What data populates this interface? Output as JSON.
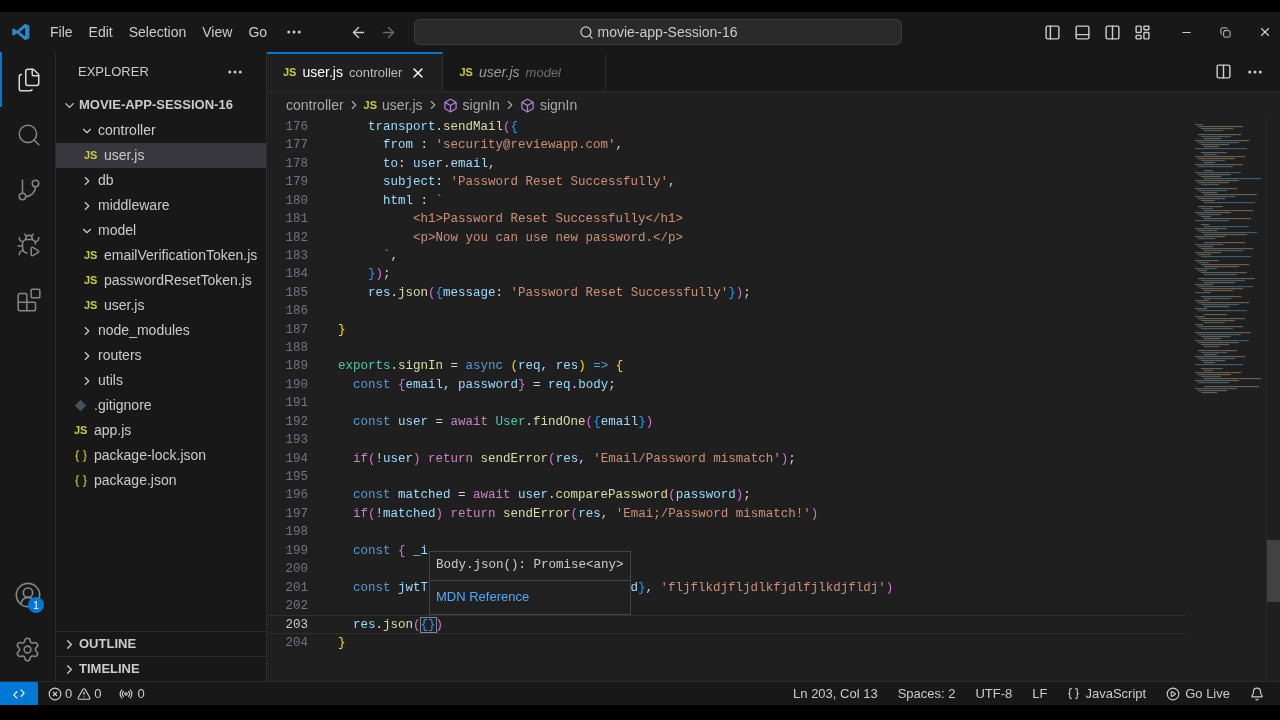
{
  "menu": [
    "File",
    "Edit",
    "Selection",
    "View",
    "Go"
  ],
  "command_center": {
    "value": "movie-app-Session-16"
  },
  "activity_bar": {
    "top": [
      {
        "selected": true
      },
      {
        "selected": false
      },
      {
        "selected": false
      },
      {
        "selected": false
      },
      {
        "selected": false
      }
    ],
    "account_badge": "1"
  },
  "sidebar": {
    "title": "EXPLORER",
    "root": {
      "label": "MOVIE-APP-SESSION-16",
      "expanded": true,
      "children": [
        {
          "kind": "folder",
          "label": "controller",
          "expanded": true,
          "selected": false,
          "children": [
            {
              "kind": "js",
              "label": "user.js",
              "badge": "JS",
              "selected": true
            }
          ]
        },
        {
          "kind": "folder",
          "label": "db",
          "expanded": false,
          "selected": false
        },
        {
          "kind": "folder",
          "label": "middleware",
          "expanded": false,
          "selected": false
        },
        {
          "kind": "folder",
          "label": "model",
          "expanded": true,
          "selected": false,
          "children": [
            {
              "kind": "js",
              "label": "emailVerificationToken.js",
              "badge": "JS",
              "selected": false
            },
            {
              "kind": "js",
              "label": "passwordResetToken.js",
              "badge": "JS",
              "selected": false
            },
            {
              "kind": "js",
              "label": "user.js",
              "badge": "JS",
              "selected": false
            }
          ]
        },
        {
          "kind": "folder",
          "label": "node_modules",
          "expanded": false,
          "selected": false
        },
        {
          "kind": "folder",
          "label": "routers",
          "expanded": false,
          "selected": false
        },
        {
          "kind": "folder",
          "label": "utils",
          "expanded": false,
          "selected": false
        },
        {
          "kind": "git",
          "label": ".gitignore",
          "selected": false
        },
        {
          "kind": "js",
          "label": "app.js",
          "badge": "JS",
          "selected": false
        },
        {
          "kind": "json",
          "label": "package-lock.json",
          "selected": false
        },
        {
          "kind": "json",
          "label": "package.json",
          "selected": false
        }
      ]
    },
    "sections": [
      {
        "label": "OUTLINE",
        "expanded": false
      },
      {
        "label": "TIMELINE",
        "expanded": false
      }
    ]
  },
  "tabs": [
    {
      "label": "user.js",
      "description": "controller",
      "badge": "JS",
      "selected": true,
      "preview": false
    },
    {
      "label": "user.js",
      "description": "model",
      "badge": "JS",
      "selected": false,
      "preview": true
    }
  ],
  "breadcrumbs": [
    {
      "kind": "folder",
      "label": "controller"
    },
    {
      "kind": "file",
      "label": "user.js",
      "badge": "JS"
    },
    {
      "kind": "symbol",
      "label": "signIn"
    },
    {
      "kind": "symbol",
      "label": "signIn"
    }
  ],
  "code": [
    {
      "number": "176",
      "active": false,
      "tokens": [
        {
          "kind": "var",
          "text": "    transport"
        },
        {
          "kind": "p",
          "text": "."
        },
        {
          "kind": "fn",
          "text": "sendMail"
        },
        {
          "kind": "b2",
          "text": "("
        },
        {
          "kind": "b3",
          "text": "{"
        }
      ]
    },
    {
      "number": "177",
      "active": false,
      "tokens": [
        {
          "kind": "var",
          "text": "      from"
        },
        {
          "kind": "p",
          "text": " : "
        },
        {
          "kind": "str",
          "text": "'security@reviewapp.com'"
        },
        {
          "kind": "p",
          "text": ","
        }
      ]
    },
    {
      "number": "178",
      "active": false,
      "tokens": [
        {
          "kind": "var",
          "text": "      to"
        },
        {
          "kind": "p",
          "text": ": "
        },
        {
          "kind": "var",
          "text": "user"
        },
        {
          "kind": "p",
          "text": "."
        },
        {
          "kind": "var",
          "text": "email"
        },
        {
          "kind": "p",
          "text": ","
        }
      ]
    },
    {
      "number": "179",
      "active": false,
      "tokens": [
        {
          "kind": "var",
          "text": "      subject"
        },
        {
          "kind": "p",
          "text": ": "
        },
        {
          "kind": "str",
          "text": "'Password Reset Successfully'"
        },
        {
          "kind": "p",
          "text": ","
        }
      ]
    },
    {
      "number": "180",
      "active": false,
      "tokens": [
        {
          "kind": "var",
          "text": "      html"
        },
        {
          "kind": "p",
          "text": " : "
        },
        {
          "kind": "str",
          "text": "`"
        }
      ]
    },
    {
      "number": "181",
      "active": false,
      "tokens": [
        {
          "kind": "str",
          "text": "          <h1>Password Reset Successfully</h1>"
        }
      ]
    },
    {
      "number": "182",
      "active": false,
      "tokens": [
        {
          "kind": "str",
          "text": "          <p>Now you can use new password.</p>"
        }
      ]
    },
    {
      "number": "183",
      "active": false,
      "tokens": [
        {
          "kind": "str",
          "text": "      `"
        },
        {
          "kind": "p",
          "text": ","
        }
      ]
    },
    {
      "number": "184",
      "active": false,
      "tokens": [
        {
          "kind": "b3",
          "text": "    }"
        },
        {
          "kind": "b2",
          "text": ")"
        },
        {
          "kind": "p",
          "text": ";"
        }
      ]
    },
    {
      "number": "185",
      "active": false,
      "tokens": [
        {
          "kind": "var",
          "text": "    res"
        },
        {
          "kind": "p",
          "text": "."
        },
        {
          "kind": "fn",
          "text": "json"
        },
        {
          "kind": "b2",
          "text": "("
        },
        {
          "kind": "b3",
          "text": "{"
        },
        {
          "kind": "var",
          "text": "message"
        },
        {
          "kind": "p",
          "text": ": "
        },
        {
          "kind": "str",
          "text": "'Password Reset Successfully'"
        },
        {
          "kind": "b3",
          "text": "}"
        },
        {
          "kind": "b2",
          "text": ")"
        },
        {
          "kind": "p",
          "text": ";"
        }
      ]
    },
    {
      "number": "186",
      "active": false
    },
    {
      "number": "187",
      "active": false,
      "tokens": [
        {
          "kind": "b1",
          "text": "}"
        }
      ]
    },
    {
      "number": "188",
      "active": false
    },
    {
      "number": "189",
      "active": false,
      "tokens": [
        {
          "kind": "cls",
          "text": "exports"
        },
        {
          "kind": "p",
          "text": "."
        },
        {
          "kind": "fn",
          "text": "signIn"
        },
        {
          "kind": "p",
          "text": " = "
        },
        {
          "kind": "kw",
          "text": "async "
        },
        {
          "kind": "b1",
          "text": "("
        },
        {
          "kind": "var",
          "text": "req"
        },
        {
          "kind": "p",
          "text": ", "
        },
        {
          "kind": "var",
          "text": "res"
        },
        {
          "kind": "b1",
          "text": ") "
        },
        {
          "kind": "kw",
          "text": "=> "
        },
        {
          "kind": "b1",
          "text": "{"
        }
      ]
    },
    {
      "number": "190",
      "active": false,
      "tokens": [
        {
          "kind": "kw",
          "text": "  const "
        },
        {
          "kind": "b2",
          "text": "{"
        },
        {
          "kind": "var",
          "text": "email"
        },
        {
          "kind": "p",
          "text": ", "
        },
        {
          "kind": "var",
          "text": "password"
        },
        {
          "kind": "b2",
          "text": "}"
        },
        {
          "kind": "p",
          "text": " = "
        },
        {
          "kind": "var",
          "text": "req"
        },
        {
          "kind": "p",
          "text": "."
        },
        {
          "kind": "var",
          "text": "body"
        },
        {
          "kind": "p",
          "text": ";"
        }
      ]
    },
    {
      "number": "191",
      "active": false
    },
    {
      "number": "192",
      "active": false,
      "tokens": [
        {
          "kind": "kw",
          "text": "  const "
        },
        {
          "kind": "var",
          "text": "user"
        },
        {
          "kind": "p",
          "text": " = "
        },
        {
          "kind": "ctl",
          "text": "await "
        },
        {
          "kind": "cls",
          "text": "User"
        },
        {
          "kind": "p",
          "text": "."
        },
        {
          "kind": "fn",
          "text": "findOne"
        },
        {
          "kind": "b2",
          "text": "("
        },
        {
          "kind": "b3",
          "text": "{"
        },
        {
          "kind": "var",
          "text": "email"
        },
        {
          "kind": "b3",
          "text": "}"
        },
        {
          "kind": "b2",
          "text": ")"
        }
      ]
    },
    {
      "number": "193",
      "active": false
    },
    {
      "number": "194",
      "active": false,
      "tokens": [
        {
          "kind": "ctl",
          "text": "  if"
        },
        {
          "kind": "b2",
          "text": "("
        },
        {
          "kind": "p",
          "text": "!"
        },
        {
          "kind": "var",
          "text": "user"
        },
        {
          "kind": "b2",
          "text": ") "
        },
        {
          "kind": "ctl",
          "text": "return "
        },
        {
          "kind": "fn",
          "text": "sendError"
        },
        {
          "kind": "b2",
          "text": "("
        },
        {
          "kind": "var",
          "text": "res"
        },
        {
          "kind": "p",
          "text": ", "
        },
        {
          "kind": "str",
          "text": "'Email/Password mismatch'"
        },
        {
          "kind": "b2",
          "text": ")"
        },
        {
          "kind": "p",
          "text": ";"
        }
      ]
    },
    {
      "number": "195",
      "active": false
    },
    {
      "number": "196",
      "active": false,
      "tokens": [
        {
          "kind": "kw",
          "text": "  const "
        },
        {
          "kind": "var",
          "text": "matched"
        },
        {
          "kind": "p",
          "text": " = "
        },
        {
          "kind": "ctl",
          "text": "await "
        },
        {
          "kind": "var",
          "text": "user"
        },
        {
          "kind": "p",
          "text": "."
        },
        {
          "kind": "fn",
          "text": "comparePassword"
        },
        {
          "kind": "b2",
          "text": "("
        },
        {
          "kind": "var",
          "text": "password"
        },
        {
          "kind": "b2",
          "text": ")"
        },
        {
          "kind": "p",
          "text": ";"
        }
      ]
    },
    {
      "number": "197",
      "active": false,
      "tokens": [
        {
          "kind": "ctl",
          "text": "  if"
        },
        {
          "kind": "b2",
          "text": "("
        },
        {
          "kind": "p",
          "text": "!"
        },
        {
          "kind": "var",
          "text": "matched"
        },
        {
          "kind": "b2",
          "text": ") "
        },
        {
          "kind": "ctl",
          "text": "return "
        },
        {
          "kind": "fn",
          "text": "sendError"
        },
        {
          "kind": "b2",
          "text": "("
        },
        {
          "kind": "var",
          "text": "res"
        },
        {
          "kind": "p",
          "text": ", "
        },
        {
          "kind": "str",
          "text": "'Emai;/Password mismatch!'"
        },
        {
          "kind": "b2",
          "text": ")"
        }
      ]
    },
    {
      "number": "198",
      "active": false
    },
    {
      "number": "199",
      "active": false,
      "tokens": [
        {
          "kind": "kw",
          "text": "  const "
        },
        {
          "kind": "b2",
          "text": "{ "
        },
        {
          "kind": "var",
          "text": "_i"
        }
      ]
    },
    {
      "number": "200",
      "active": false
    },
    {
      "number": "201",
      "active": false,
      "tokens": [
        {
          "kind": "kw",
          "text": "  const "
        },
        {
          "kind": "var",
          "text": "jwtT"
        },
        {
          "kind": "covered"
        },
        {
          "kind": "var",
          "text": "d"
        },
        {
          "kind": "b3",
          "text": "}"
        },
        {
          "kind": "p",
          "text": ", "
        },
        {
          "kind": "str",
          "text": "'fljflkdjfljdlkfjdlfjlkdjfldj'"
        },
        {
          "kind": "b2",
          "text": ")"
        }
      ]
    },
    {
      "number": "202",
      "active": false
    },
    {
      "number": "203",
      "active": true,
      "tokens": [
        {
          "kind": "var",
          "text": "  res"
        },
        {
          "kind": "p",
          "text": "."
        },
        {
          "kind": "fn",
          "text": "json"
        },
        {
          "kind": "b2",
          "text": "("
        },
        {
          "kind": "match",
          "text": "{}"
        },
        {
          "kind": "b2",
          "text": ")"
        }
      ]
    },
    {
      "number": "204",
      "active": false,
      "tokens": [
        {
          "kind": "b1",
          "text": "}"
        }
      ]
    }
  ],
  "hover": {
    "signature": "Body.json(): Promise<any>",
    "link": "MDN Reference"
  },
  "status_bar": {
    "errors": "0",
    "warnings": "0",
    "ports": "0",
    "right": [
      {
        "kind": "text",
        "label": "Ln 203, Col 13"
      },
      {
        "kind": "text",
        "label": "Spaces: 2"
      },
      {
        "kind": "text",
        "label": "UTF-8"
      },
      {
        "kind": "text",
        "label": "LF"
      },
      {
        "kind": "language",
        "label": "JavaScript"
      },
      {
        "kind": "live",
        "label": "Go Live"
      }
    ]
  }
}
